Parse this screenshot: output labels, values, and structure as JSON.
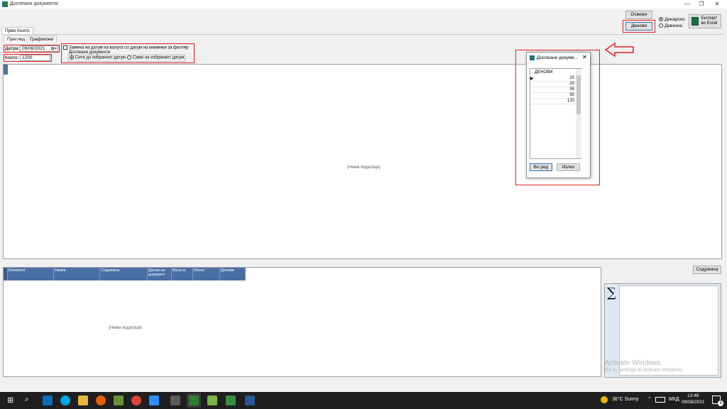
{
  "window": {
    "title": "Доспеани документи",
    "minimize": "—",
    "restore": "❐",
    "close": "✕"
  },
  "toolbar": {
    "refresh_label": "Освежи",
    "days_label": "Денови",
    "radio_denars": "Денарско",
    "radio_foreign": "Девизно",
    "export_label": "Експорт во Excel"
  },
  "tabs": {
    "outer": "Прво Конто",
    "preview": "Преглед",
    "charts": "Графикони"
  },
  "filters": {
    "date_label": "Датум:",
    "date_value": "09/08/2021",
    "account_label": "Конто:",
    "account_value": "1200",
    "replace_date_check": "Замена на датум на валута со датум на книжење за филтер",
    "due_docs_title": "Доспеани документи",
    "radio_all": "Сите до избраниот датум",
    "radio_only": "Само на избраниот датум"
  },
  "main_empty": "(Нема податоци)",
  "grid": {
    "columns": [
      "Конинент",
      "Назив",
      "Содржина",
      "Датум на документ",
      "Валута",
      "Износ",
      "Денови"
    ],
    "empty": "(Нема податоци)"
  },
  "content_button": "Содржина",
  "sigma": "∑",
  "activate": {
    "line1": "Activate Windows",
    "line2": "Go to Settings to activate Windows."
  },
  "dialog": {
    "title": "Доспеани докуме...",
    "column": "ДЕНОВИ",
    "rows": [
      "10",
      "20",
      "35",
      "50",
      "120"
    ],
    "ok_label": "Во ред",
    "exit_label": "Излез",
    "close": "✕"
  },
  "taskbar": {
    "weather": "36°C  Sunny",
    "lang": "МКД",
    "time": "13:48",
    "date": "09/08/2021",
    "notif_count": "3"
  },
  "colors": {
    "highlight": "#e02020",
    "grid_header": "#4a6fa5",
    "taskbar": "#1f1f1f"
  }
}
